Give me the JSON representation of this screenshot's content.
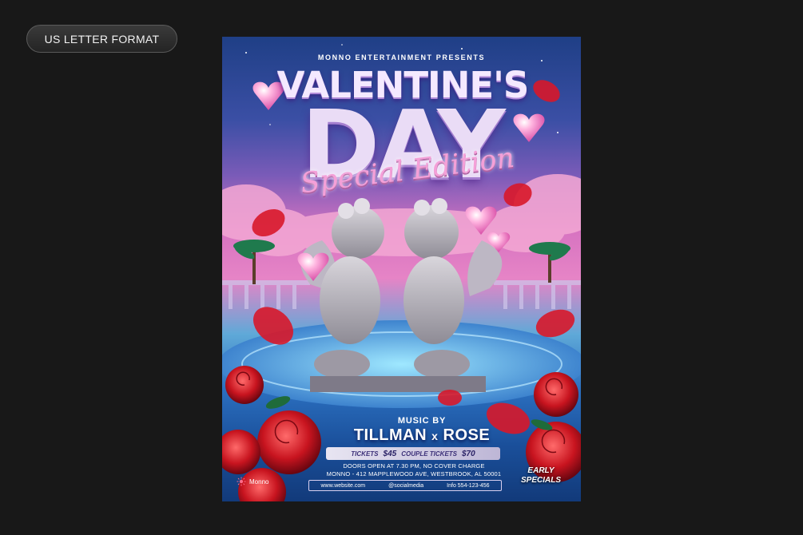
{
  "format_label": "US LETTER FORMAT",
  "flyer": {
    "presents": "MONNO ENTERTAINMENT PRESENTS",
    "title_line1": "VALENTINE'S",
    "title_line2": "DAY",
    "subtitle": "Special Edition",
    "music_by": "MUSIC BY",
    "artist1": "TILLMAN",
    "artist_sep": "x",
    "artist2": "ROSE",
    "tickets_label": "TICKETS",
    "tickets_price": "$45",
    "couple_label": "COUPLE TICKETS",
    "couple_price": "$70",
    "doors": "DOORS OPEN AT 7.30 PM, NO COVER CHARGE",
    "address": "MONNO - 412 MAPPLEWOOD AVE, WESTBROOK, AL 50001",
    "website": "www.website.com",
    "social": "@socialmedia",
    "phone": "Info 554-123-456",
    "brand": "Monno",
    "early_line1": "EARLY",
    "early_line2": "SPECIALS"
  },
  "colors": {
    "background": "#181818",
    "accent_pink": "#e684c6",
    "accent_blue": "#2b6fbf",
    "rose_red": "#d21f2f"
  }
}
